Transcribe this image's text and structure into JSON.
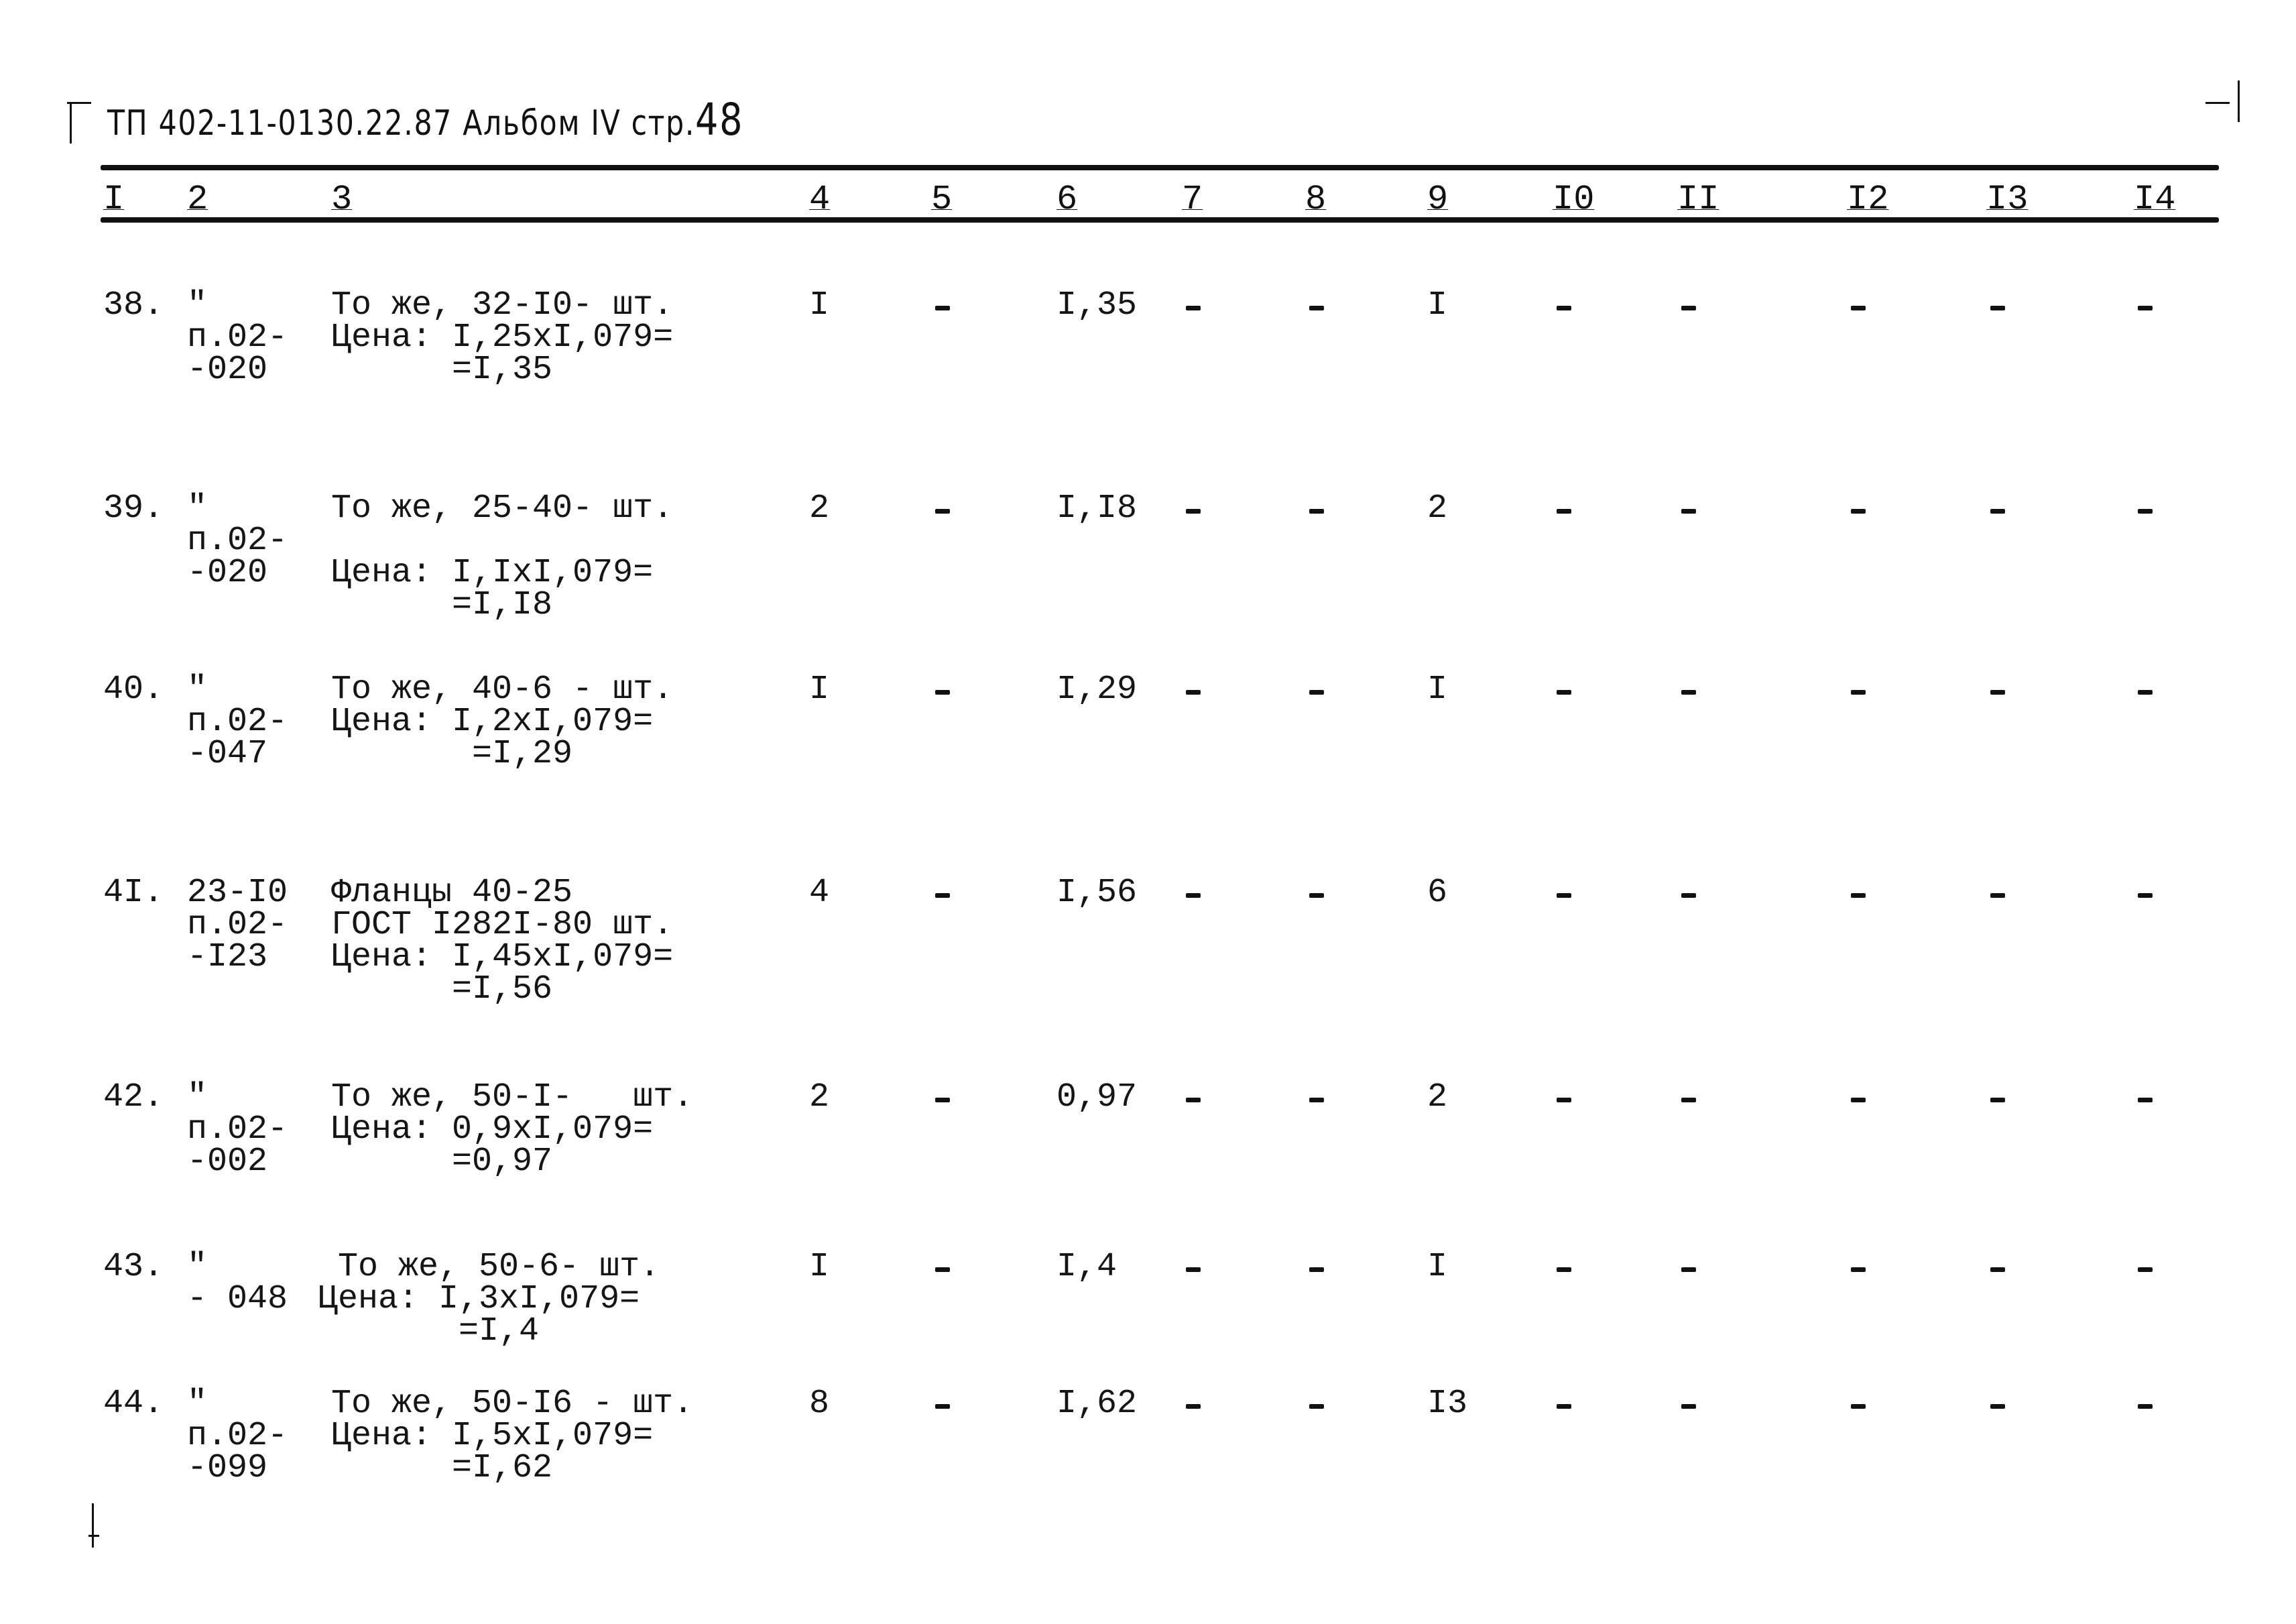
{
  "header": {
    "doc_code": "ТП 402-11-0130.22.87",
    "album": "Альбом IV",
    "page_label": "стр.",
    "page_number": "48"
  },
  "columns": [
    "I",
    "2",
    "3",
    "4",
    "5",
    "6",
    "7",
    "8",
    "9",
    "I0",
    "II",
    "I2",
    "I3",
    "I4"
  ],
  "rows": [
    {
      "no": "38.",
      "ref": [
        "\"",
        "п.02-",
        "-020"
      ],
      "desc": [
        "То же, 32-I0- шт.",
        "Цена: I,25хI,079=",
        "      =I,35"
      ],
      "c4": "I",
      "c5": "–",
      "c6": "I,35",
      "c7": "–",
      "c8": "–",
      "c9": "I",
      "c10": "–",
      "c11": "–",
      "c12": "–",
      "c13": "–",
      "c14": "–"
    },
    {
      "no": "39.",
      "ref": [
        "\"",
        "п.02-",
        "-020"
      ],
      "desc": [
        "То же, 25-40- шт.",
        "",
        "Цена: I,IхI,079=",
        "      =I,I8"
      ],
      "c4": "2",
      "c5": "–",
      "c6": "I,I8",
      "c7": "–",
      "c8": "–",
      "c9": "2",
      "c10": "–",
      "c11": "–",
      "c12": "–",
      "c13": "–",
      "c14": "–"
    },
    {
      "no": "40.",
      "ref": [
        "\"",
        "п.02-",
        "-047"
      ],
      "desc": [
        "То же, 40-6 - шт.",
        "Цена: I,2хI,079=",
        "       =I,29"
      ],
      "c4": "I",
      "c5": "–",
      "c6": "I,29",
      "c7": "–",
      "c8": "–",
      "c9": "I",
      "c10": "–",
      "c11": "–",
      "c12": "–",
      "c13": "–",
      "c14": "–"
    },
    {
      "no": "4I.",
      "ref": [
        "23-I0",
        "п.02-",
        "-I23"
      ],
      "desc": [
        "Фланцы 40-25",
        "ГОСТ I282I-80 шт.",
        "Цена: I,45хI,079=",
        "      =I,56"
      ],
      "c4": "4",
      "c5": "–",
      "c6": "I,56",
      "c7": "–",
      "c8": "–",
      "c9": "6",
      "c10": "–",
      "c11": "–",
      "c12": "–",
      "c13": "–",
      "c14": "–"
    },
    {
      "no": "42.",
      "ref": [
        "\"",
        "п.02-",
        "-002"
      ],
      "desc": [
        "То же, 50-I-   шт.",
        "Цена: 0,9хI,079=",
        "      =0,97"
      ],
      "c4": "2",
      "c5": "–",
      "c6": "0,97",
      "c7": "–",
      "c8": "–",
      "c9": "2",
      "c10": "–",
      "c11": "–",
      "c12": "–",
      "c13": "–",
      "c14": "–"
    },
    {
      "no": "43.",
      "ref": [
        "\"",
        "- 048"
      ],
      "desc": [
        " То же, 50-6- шт.",
        "Цена: I,3хI,079=",
        "       =I,4"
      ],
      "c4": "I",
      "c5": "–",
      "c6": "I,4",
      "c7": "–",
      "c8": "–",
      "c9": "I",
      "c10": "–",
      "c11": "–",
      "c12": "–",
      "c13": "–",
      "c14": "–"
    },
    {
      "no": "44.",
      "ref": [
        "\"",
        "п.02-",
        "-099"
      ],
      "desc": [
        "То же, 50-I6 - шт.",
        "Цена: I,5хI,079=",
        "      =I,62"
      ],
      "c4": "8",
      "c5": "–",
      "c6": "I,62",
      "c7": "–",
      "c8": "–",
      "c9": "I3",
      "c10": "–",
      "c11": "–",
      "c12": "–",
      "c13": "–",
      "c14": "–"
    }
  ]
}
